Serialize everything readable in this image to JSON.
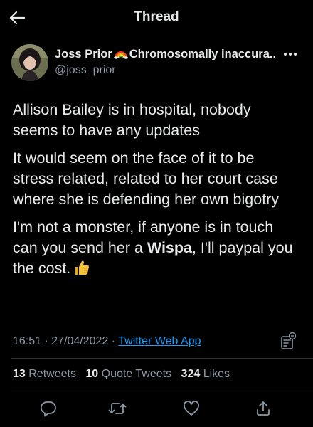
{
  "header": {
    "title": "Thread",
    "back_icon": "arrow-left-icon"
  },
  "author": {
    "name": "Joss Prior",
    "name_emoji": "rainbow-emoji",
    "display_suffix": "Chromosomally inaccura...",
    "handle": "@joss_prior",
    "more_icon": "more-icon"
  },
  "tweet": {
    "p1": "Allison Bailey is in hospital, nobody seems to have any updates",
    "p2": "It would seem on the face of it to be stress related, related to her court case where she is defending her own bigotry",
    "p3_before": "I'm not a monster, if anyone is in touch can you send her a ",
    "p3_bold": "Wispa",
    "p3_after": ", I'll paypal you the cost.",
    "p3_emoji": "thumbs-up-emoji"
  },
  "meta": {
    "time": "16:51",
    "separator1": " · ",
    "date": "27/04/2022",
    "separator2": " · ",
    "source": "Twitter Web App"
  },
  "stats": {
    "retweets_count": "13",
    "retweets_label": "Retweets",
    "quotes_count": "10",
    "quotes_label": "Quote Tweets",
    "likes_count": "324",
    "likes_label": "Likes"
  },
  "actions": [
    "reply-icon",
    "retweet-icon",
    "like-icon",
    "share-icon"
  ],
  "colors": {
    "background": "#000000",
    "text": "#e7e9ea",
    "secondary": "#8b98a5",
    "link": "#1d9bf0",
    "divider": "#2f3336"
  }
}
